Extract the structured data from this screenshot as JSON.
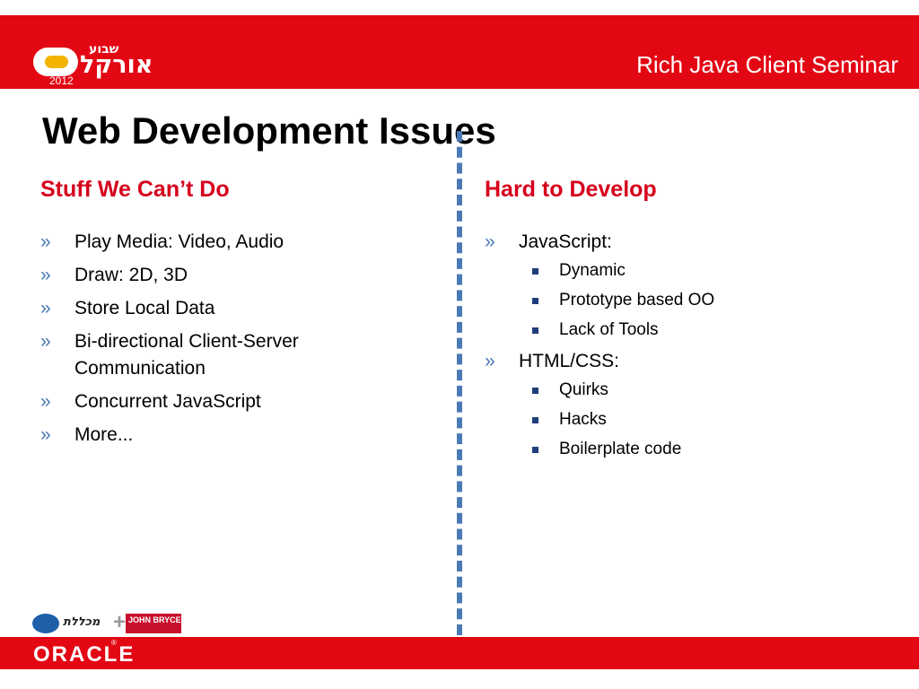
{
  "header": {
    "logo": {
      "hebrew_main": "אורקל",
      "hebrew_small": "שבוע",
      "year": "2012"
    },
    "seminar_title": "Rich Java Client Seminar",
    "brand_color": "#e30613"
  },
  "title": "Web Development Issues",
  "left_column": {
    "heading": "Stuff We Can’t Do",
    "bullet": "»",
    "items": [
      "Play Media: Video, Audio",
      "Draw: 2D, 3D",
      "Store Local Data",
      "Bi-directional Client-Server Communication",
      "Concurrent JavaScript",
      "More..."
    ]
  },
  "right_column": {
    "heading": "Hard to Develop",
    "bullet": "»",
    "groups": [
      {
        "label": "JavaScript:",
        "subitems": [
          "Dynamic",
          "Prototype based OO",
          "Lack of Tools"
        ]
      },
      {
        "label": "HTML/CSS:",
        "subitems": [
          "Quirks",
          "Hacks",
          "Boilerplate code"
        ]
      }
    ]
  },
  "footer": {
    "brand": "ORACLE",
    "registered": "®",
    "sponsor_logo_text": "מכללת",
    "sponsor_box_text": "JOHN BRYCE",
    "icons": [
      "sponsor-logo",
      "oracle-logo"
    ]
  }
}
